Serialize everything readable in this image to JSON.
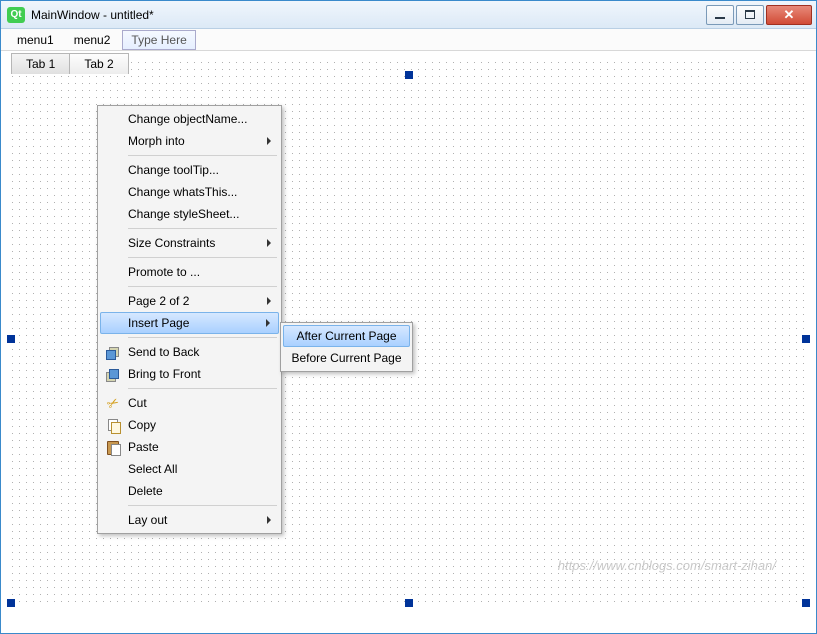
{
  "window": {
    "title": "MainWindow - untitled*",
    "app_icon_label": "Qt"
  },
  "menubar": {
    "items": [
      "menu1",
      "menu2"
    ],
    "type_here": "Type Here"
  },
  "tabs": {
    "items": [
      "Tab 1",
      "Tab 2"
    ]
  },
  "context_menu": {
    "items": [
      {
        "label": "Change objectName...",
        "type": "item"
      },
      {
        "label": "Morph into",
        "type": "submenu"
      },
      {
        "type": "sep"
      },
      {
        "label": "Change toolTip...",
        "type": "item"
      },
      {
        "label": "Change whatsThis...",
        "type": "item"
      },
      {
        "label": "Change styleSheet...",
        "type": "item"
      },
      {
        "type": "sep"
      },
      {
        "label": "Size Constraints",
        "type": "submenu"
      },
      {
        "type": "sep"
      },
      {
        "label": "Promote to ...",
        "type": "item"
      },
      {
        "type": "sep"
      },
      {
        "label": "Page 2 of 2",
        "type": "submenu"
      },
      {
        "label": "Insert Page",
        "type": "submenu",
        "highlight": true
      },
      {
        "type": "sep"
      },
      {
        "label": "Send to Back",
        "type": "item",
        "icon": "send-to-back"
      },
      {
        "label": "Bring to Front",
        "type": "item",
        "icon": "bring-to-front"
      },
      {
        "type": "sep"
      },
      {
        "label": "Cut",
        "type": "item",
        "icon": "cut"
      },
      {
        "label": "Copy",
        "type": "item",
        "icon": "copy"
      },
      {
        "label": "Paste",
        "type": "item",
        "icon": "paste"
      },
      {
        "label": "Select All",
        "type": "item"
      },
      {
        "label": "Delete",
        "type": "item"
      },
      {
        "type": "sep"
      },
      {
        "label": "Lay out",
        "type": "submenu"
      }
    ]
  },
  "submenu": {
    "items": [
      {
        "label": "After Current Page",
        "highlight": true
      },
      {
        "label": "Before Current Page"
      }
    ]
  },
  "watermark": "https://www.cnblogs.com/smart-zihan/"
}
